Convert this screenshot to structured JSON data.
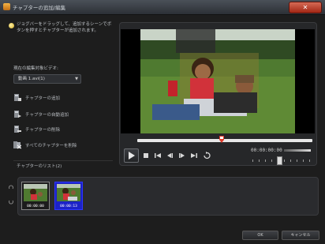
{
  "window": {
    "title": "チャプターの追加/編集",
    "close_glyph": "✕"
  },
  "hint": {
    "text": "ジョグバーをドラッグして、追加するシーンでボタンを押すとチャプターが追加されます。"
  },
  "chapter_mode": {
    "label": "現在の編集対象ビデオ:",
    "selected": "動画 1.avi(1)",
    "arrow": "▼"
  },
  "actions": [
    {
      "label": "チャプターの追加",
      "icon": "add-chapter-icon"
    },
    {
      "label": "チャプターの自動追加",
      "icon": "auto-chapter-icon"
    },
    {
      "label": "チャプターの削除",
      "icon": "delete-chapter-icon"
    },
    {
      "label": "すべてのチャプターを削除",
      "icon": "delete-all-icon"
    }
  ],
  "chapters_list": {
    "label": "チャプターのリスト(2)"
  },
  "player": {
    "timecode": "00:00:00:00",
    "scrub_position_pct": 49
  },
  "thumbnails": [
    {
      "timecode": "00:00:00",
      "selected": false
    },
    {
      "timecode": "00:00:13",
      "selected": true
    }
  ],
  "buttons": {
    "ok": "OK",
    "cancel": "キャンセル"
  },
  "colors": {
    "accent_selected": "#1c22c8",
    "close_red": "#a32715",
    "scrub_marker": "#e03b2b"
  }
}
